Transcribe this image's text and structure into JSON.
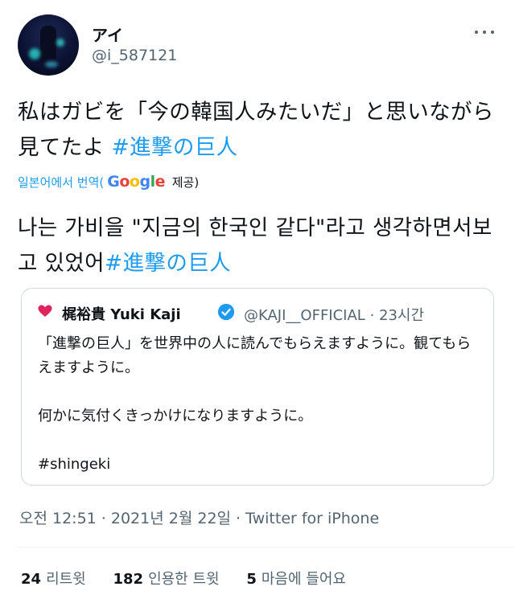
{
  "author": {
    "name": "アイ",
    "handle": "@i_587121"
  },
  "tweet": {
    "text": "私はガビを「今の韓国人みたいだ」と思いながら見てたよ ",
    "hashtag": "#進撃の巨人"
  },
  "translation": {
    "label_prefix": "일본어에서 번역(",
    "google": "Google",
    "label_suffix": " 제공)",
    "text": "나는 가비을 \"지금의 한국인 같다\"라고 생각하면서보고 있었어",
    "hashtag": "#進撃の巨人"
  },
  "quote": {
    "name": "梶裕貴 Yuki Kaji",
    "handle": "@KAJI__OFFICIAL",
    "time": "· 23시간",
    "lines": [
      "「進撃の巨人」を世界中の人に読んでもらえますように。観てもらえますように。",
      "",
      "何かに気付くきっかけになりますように。",
      "",
      "#shingeki"
    ]
  },
  "timestamp": {
    "time": "오전 12:51 · 2021년 2월 22일",
    "separator": " · ",
    "source": "Twitter for iPhone"
  },
  "stats": {
    "retweets": "24",
    "retweets_label": "리트윗",
    "quotes": "182",
    "quotes_label": "인용한 트윗",
    "likes": "5",
    "likes_label": "마음에 들어요"
  },
  "colors": {
    "link": "#1d9bf0",
    "secondary": "#536471",
    "verified": "#1d9bf0",
    "heart": "#e0245e"
  }
}
